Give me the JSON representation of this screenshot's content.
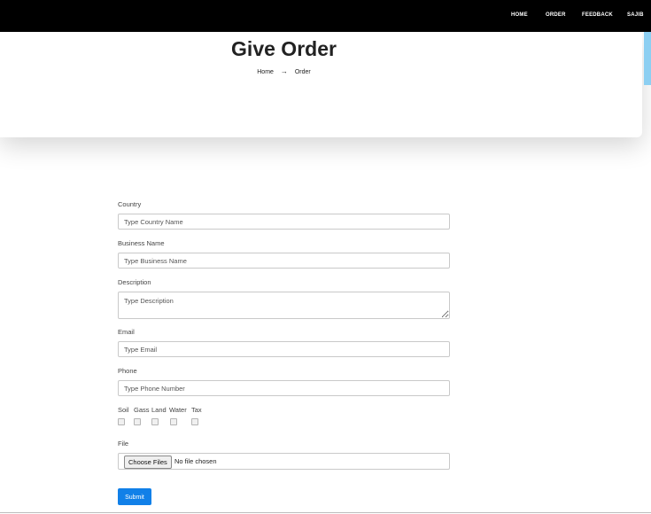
{
  "nav": {
    "items": [
      "HOME",
      "ORDER",
      "FEEDBACK",
      "SAJIB"
    ]
  },
  "header": {
    "title": "Give Order",
    "breadcrumb": {
      "home": "Home",
      "arrow": "→",
      "current": "Order"
    }
  },
  "form": {
    "country": {
      "label": "Country",
      "placeholder": "Type Country Name"
    },
    "business": {
      "label": "Business Name",
      "placeholder": "Type Business Name"
    },
    "description": {
      "label": "Description",
      "placeholder": "Type Description"
    },
    "email": {
      "label": "Email",
      "placeholder": "Type Email"
    },
    "phone": {
      "label": "Phone",
      "placeholder": "Type Phone Number"
    },
    "tax_options": [
      "Soil",
      "Gass",
      "Land",
      "Water",
      "Tax"
    ],
    "file": {
      "label": "File",
      "button": "Choose Files",
      "status": "No file chosen"
    },
    "submit": "Submit"
  },
  "colors": {
    "nav_bg": "#000000",
    "accent": "#1180e8",
    "scroll_accent": "#8ccff2"
  }
}
